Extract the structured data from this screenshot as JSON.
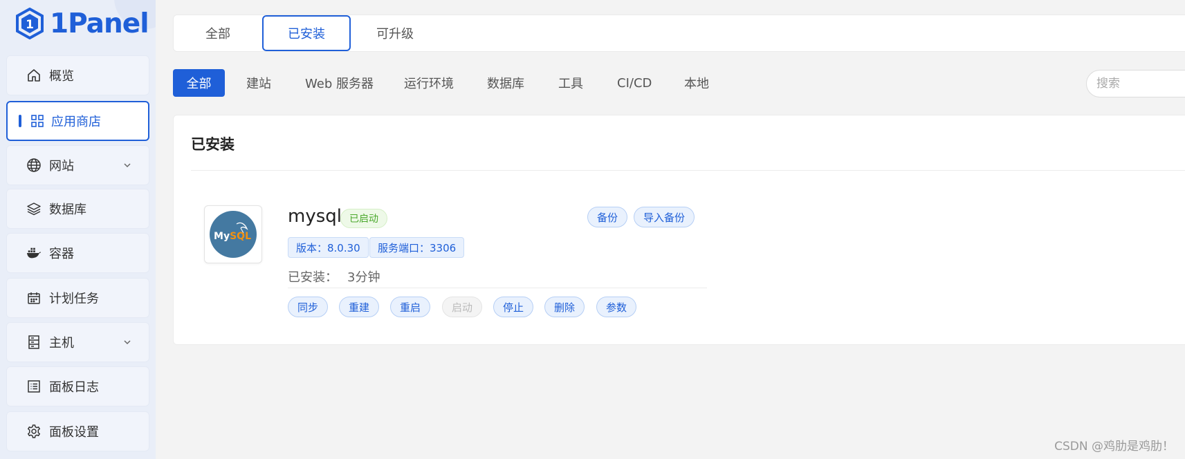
{
  "brand": {
    "name": "1Panel",
    "color": "#1f5fd8"
  },
  "sidebar": {
    "items": [
      {
        "label": "概览",
        "icon": "home-icon"
      },
      {
        "label": "应用商店",
        "icon": "grid-icon",
        "active": true
      },
      {
        "label": "网站",
        "icon": "globe-icon",
        "expandable": true
      },
      {
        "label": "数据库",
        "icon": "layers-icon"
      },
      {
        "label": "容器",
        "icon": "docker-icon"
      },
      {
        "label": "计划任务",
        "icon": "calendar-icon"
      },
      {
        "label": "主机",
        "icon": "server-icon",
        "expandable": true
      },
      {
        "label": "面板日志",
        "icon": "log-icon"
      },
      {
        "label": "面板设置",
        "icon": "gear-icon"
      }
    ]
  },
  "top_tabs": [
    {
      "label": "全部"
    },
    {
      "label": "已安装",
      "active": true
    },
    {
      "label": "可升级"
    }
  ],
  "categories": [
    {
      "label": "全部",
      "active": true
    },
    {
      "label": "建站"
    },
    {
      "label": "Web 服务器"
    },
    {
      "label": "运行环境"
    },
    {
      "label": "数据库"
    },
    {
      "label": "工具"
    },
    {
      "label": "CI/CD"
    },
    {
      "label": "本地"
    }
  ],
  "search": {
    "placeholder": "搜索"
  },
  "installed": {
    "title": "已安装",
    "app": {
      "name": "mysql",
      "logo_text": "MySQL",
      "status": "已启动",
      "version_tag": "版本：8.0.30",
      "port_tag": "服务端口：3306",
      "installed_label": "已安装：",
      "installed_value": "3分钟",
      "backup_label": "备份",
      "import_backup_label": "导入备份",
      "actions": [
        {
          "label": "同步"
        },
        {
          "label": "重建"
        },
        {
          "label": "重启"
        },
        {
          "label": "启动",
          "disabled": true
        },
        {
          "label": "停止"
        },
        {
          "label": "删除"
        },
        {
          "label": "参数"
        }
      ]
    }
  },
  "watermark": "CSDN @鸡肋是鸡肋！"
}
